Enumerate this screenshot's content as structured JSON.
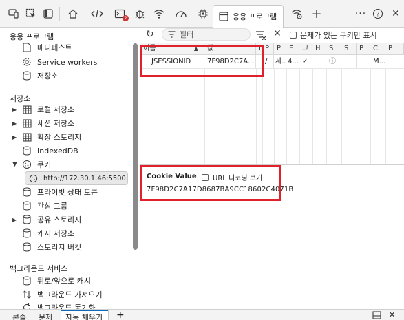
{
  "toolbar": {
    "icons": [
      "device-icon",
      "inspect-icon",
      "panel-icon",
      "welcome-icon",
      "sources-icon",
      "console-icon",
      "bug-icon",
      "network-icon",
      "performance-icon",
      "memory-icon",
      "application-icon",
      "wifi-settings-icon",
      "add-icon",
      "more-icon",
      "help-icon",
      "close-icon"
    ],
    "console_badge": "2",
    "active_tab_label": "응용 프로그램"
  },
  "sidebar": {
    "app_section": "응용 프로그램",
    "app_items": [
      {
        "label": "매니페스트",
        "icon": "document-icon"
      },
      {
        "label": "Service workers",
        "icon": "gear-icon"
      },
      {
        "label": "저장소",
        "icon": "database-icon"
      }
    ],
    "storage_section": "저장소",
    "storage_items": [
      {
        "label": "로컬 저장소",
        "icon": "grid-icon"
      },
      {
        "label": "세션 저장소",
        "icon": "grid-icon"
      },
      {
        "label": "확장 스토리지",
        "icon": "grid-icon"
      },
      {
        "label": "IndexedDB",
        "icon": "database-icon"
      },
      {
        "label": "쿠키",
        "icon": "cookie-icon"
      }
    ],
    "cookie_origin": "http://172.30.1.46:5500",
    "more_items": [
      {
        "label": "프라이빗 상태 토큰",
        "icon": "database-icon"
      },
      {
        "label": "관심 그룹",
        "icon": "database-icon"
      },
      {
        "label": "공유 스토리지",
        "icon": "database-icon"
      },
      {
        "label": "캐시 저장소",
        "icon": "database-icon"
      },
      {
        "label": "스토리지 버킷",
        "icon": "database-icon"
      }
    ],
    "bg_section": "백그라운드 서비스",
    "bg_items": [
      {
        "label": "뒤로/앞으로 캐시",
        "icon": "database-icon"
      },
      {
        "label": "백그라운드 가져오기",
        "icon": "sync-icon"
      },
      {
        "label": "백그라운드 동기화",
        "icon": "refresh-icon"
      }
    ]
  },
  "cookie_toolbar": {
    "filter_placeholder": "필터",
    "third_party_label": "문제가 있는 쿠키만 표시"
  },
  "cookie_table": {
    "columns": [
      "이름",
      "값",
      "D",
      "P",
      "P",
      "E",
      "크",
      "H",
      "S",
      "S",
      "P",
      "C",
      "P"
    ],
    "rows": [
      {
        "cells": [
          "JSESSIONID",
          "7F98D2C7A...",
          "",
          "/",
          "세...",
          "4...",
          "✓",
          "",
          "ⓘ",
          "",
          "",
          "M..."
        ]
      }
    ]
  },
  "cookie_value": {
    "label": "Cookie Value",
    "decode_label": "URL 디코딩 보기",
    "value": "7F98D2C7A17D8687BA9CC18602C4071B"
  },
  "drawer": {
    "tabs": [
      "콘솔",
      "문제",
      "자동 채우기"
    ],
    "active_index": 2
  },
  "colors": {
    "accent": "#0f6cbd",
    "highlight": "#e0202a",
    "badge": "#d13438"
  }
}
